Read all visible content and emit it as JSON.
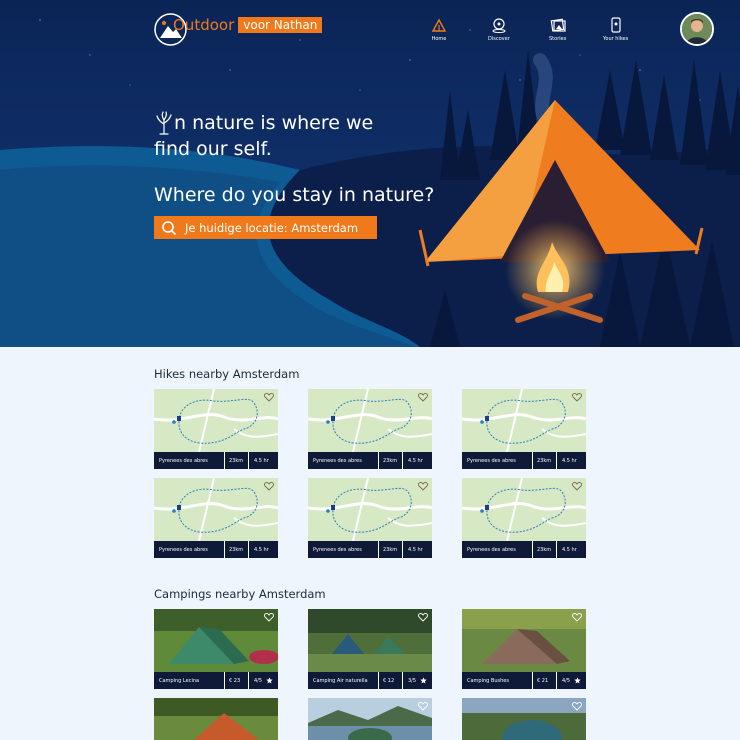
{
  "header": {
    "brand_word": "Outdoor",
    "brand_name": "voor Nathan",
    "nav": [
      {
        "label": "Home",
        "icon": "tent-icon"
      },
      {
        "label": "Discover",
        "icon": "compass-icon"
      },
      {
        "label": "Stories",
        "icon": "photos-icon"
      },
      {
        "label": "Your hikes",
        "icon": "phone-icon"
      }
    ]
  },
  "hero": {
    "headline_line1": "n nature is where we",
    "headline_line2": "find our self.",
    "question": "Where do you stay in nature?",
    "search_value": "Je huidige locatie: Amsterdam"
  },
  "hikes": {
    "title": "Hikes nearby Amsterdam",
    "items": [
      {
        "name": "Pyrenees des abres",
        "distance": "23km",
        "duration": "4.5 hr"
      },
      {
        "name": "Pyrenees des abres",
        "distance": "23km",
        "duration": "4.5 hr"
      },
      {
        "name": "Pyrenees des abres",
        "distance": "23km",
        "duration": "4.5 hr"
      },
      {
        "name": "Pyrenees des abres",
        "distance": "23km",
        "duration": "4.5 hr"
      },
      {
        "name": "Pyrenees des abres",
        "distance": "23km",
        "duration": "4.5 hr"
      },
      {
        "name": "Pyrenees des abres",
        "distance": "23km",
        "duration": "4.5 hr"
      }
    ]
  },
  "campings": {
    "title": "Campings nearby Amsterdam",
    "items": [
      {
        "name": "Camping Lecina",
        "price": "€ 23",
        "rating": "4/5"
      },
      {
        "name": "Camping Air naturella",
        "price": "€ 12",
        "rating": "3/5"
      },
      {
        "name": "Camping Bushes",
        "price": "€ 21",
        "rating": "4/5"
      }
    ]
  },
  "colors": {
    "accent": "#f07a1b",
    "navy": "#0f1938",
    "sky": "#0d2a5c"
  }
}
